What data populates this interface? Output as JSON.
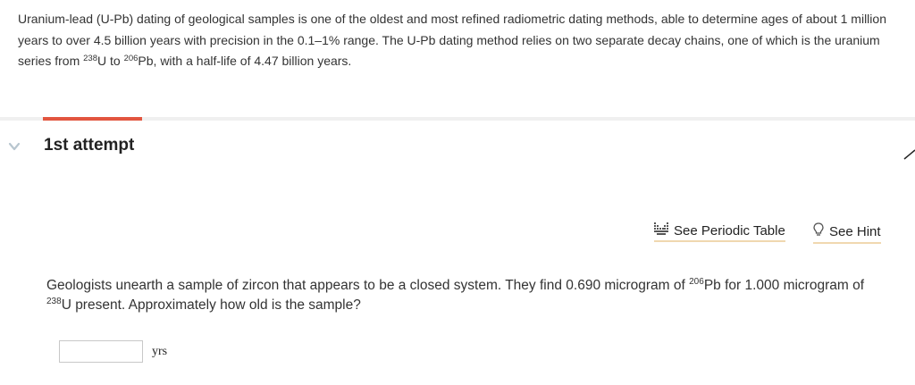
{
  "intro": {
    "part1": "Uranium-lead (U-Pb) dating of geological samples is one of the oldest and most refined radiometric dating methods, able to determine ages of about 1 million years to over 4.5 billion years with precision in the 0.1–1% range. The U-Pb dating method relies on two separate decay chains, one of which is the uranium series from ",
    "sup1": "238",
    "part2": "U to ",
    "sup2": "206",
    "part3": "Pb, with a half-life of 4.47 billion years."
  },
  "attempt": {
    "title": "1st attempt"
  },
  "tools": {
    "periodic_table": "See Periodic Table",
    "hint": "See Hint"
  },
  "question": {
    "part1": "Geologists unearth a sample of zircon that appears to be a closed system. They find 0.690 microgram of ",
    "sup1": "206",
    "part2": "Pb for 1.000 microgram of ",
    "sup2": "238",
    "part3": "U present. Approximately how old is the sample?"
  },
  "answer": {
    "value": "",
    "unit": "yrs"
  },
  "colors": {
    "accent": "#e2553f",
    "chevron": "#b8c6cf",
    "divider": "#f0f0f0"
  }
}
